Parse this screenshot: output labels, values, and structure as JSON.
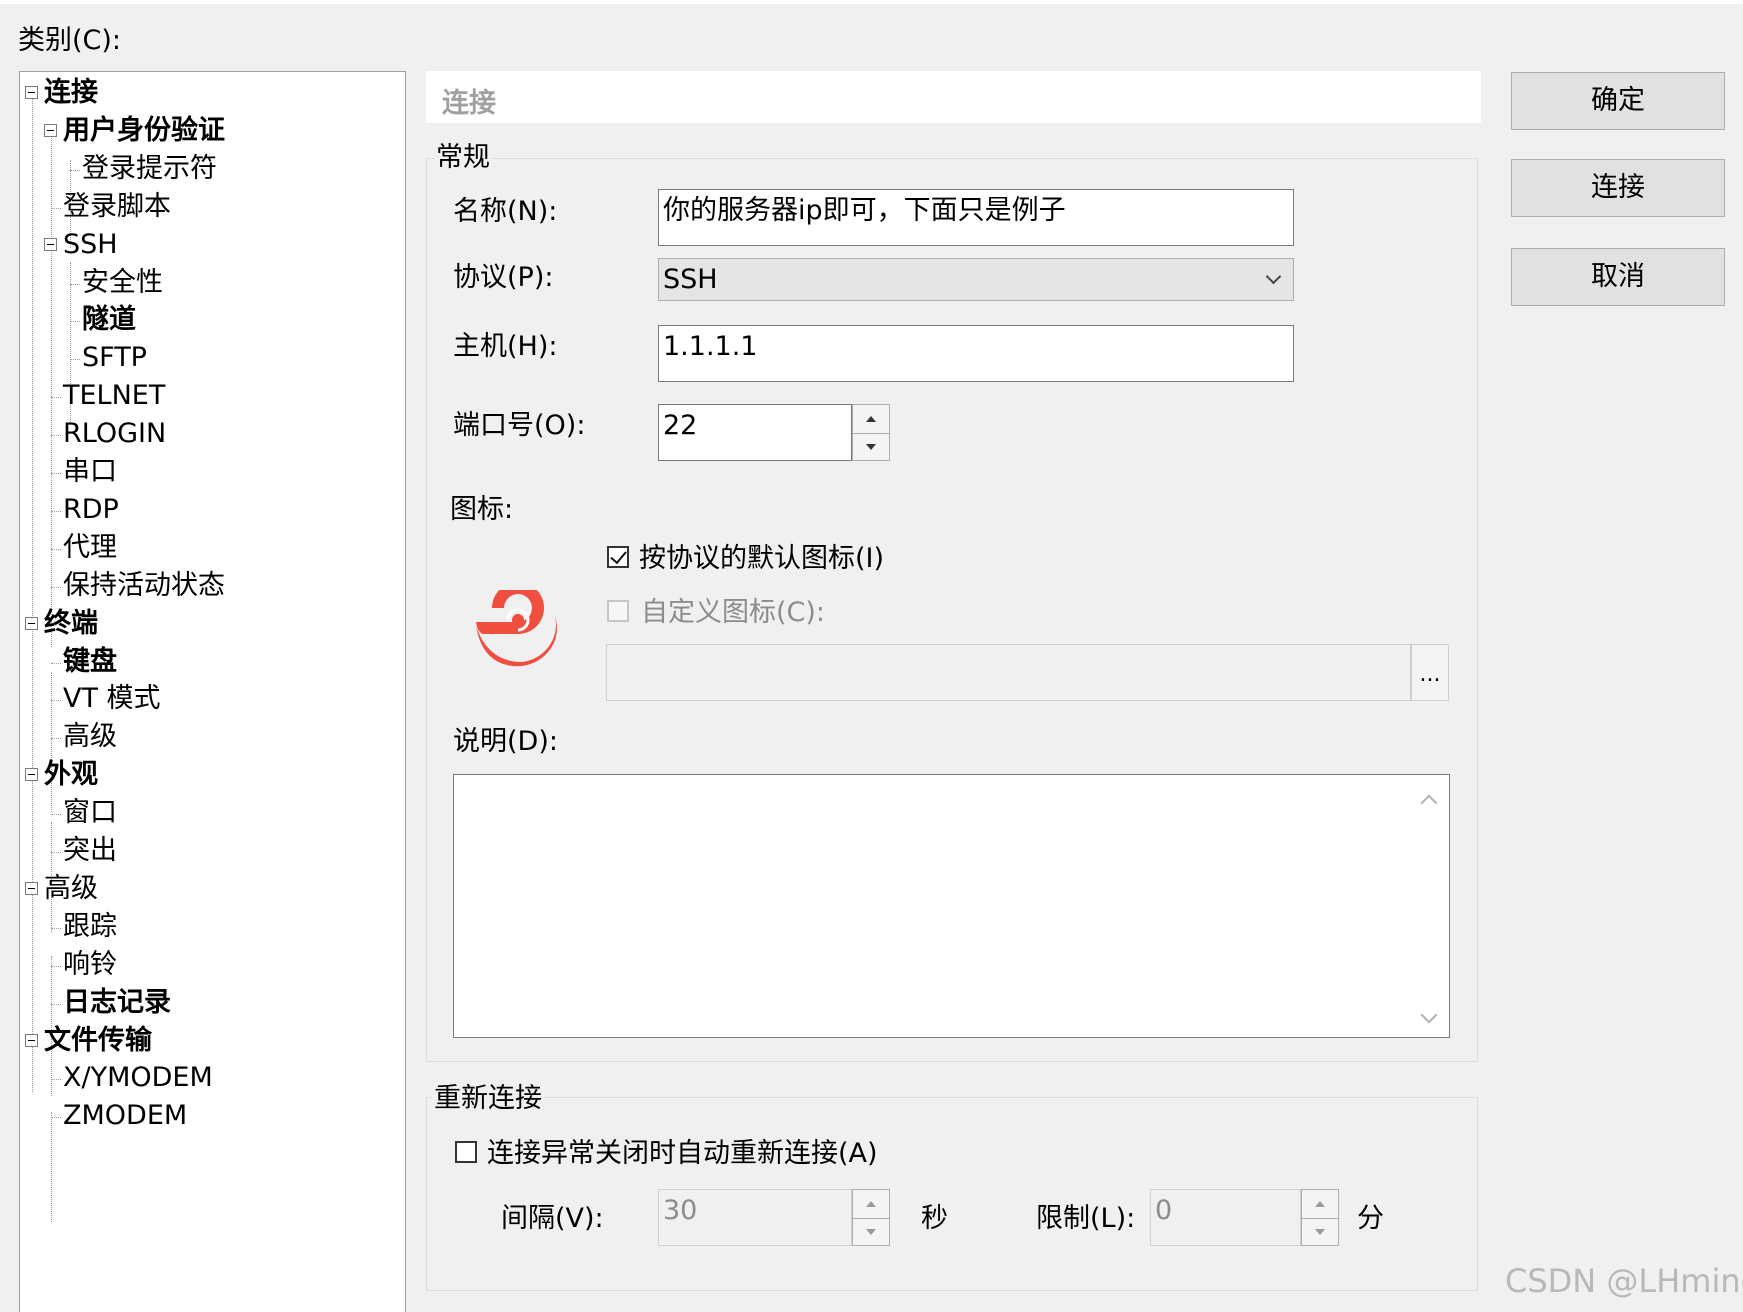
{
  "category_label": "类别(C):",
  "tree": [
    {
      "label": "连接",
      "depth": 0,
      "expanded": true,
      "bold": true
    },
    {
      "label": "用户身份验证",
      "depth": 1,
      "expanded": true,
      "bold": true
    },
    {
      "label": "登录提示符",
      "depth": 2
    },
    {
      "label": "登录脚本",
      "depth": 1
    },
    {
      "label": "SSH",
      "depth": 1,
      "expanded": true
    },
    {
      "label": "安全性",
      "depth": 2
    },
    {
      "label": "隧道",
      "depth": 2,
      "bold": true
    },
    {
      "label": "SFTP",
      "depth": 2
    },
    {
      "label": "TELNET",
      "depth": 1
    },
    {
      "label": "RLOGIN",
      "depth": 1
    },
    {
      "label": "串口",
      "depth": 1
    },
    {
      "label": "RDP",
      "depth": 1
    },
    {
      "label": "代理",
      "depth": 1
    },
    {
      "label": "保持活动状态",
      "depth": 1
    },
    {
      "label": "终端",
      "depth": 0,
      "expanded": true,
      "bold": true
    },
    {
      "label": "键盘",
      "depth": 1,
      "bold": true
    },
    {
      "label": "VT 模式",
      "depth": 1
    },
    {
      "label": "高级",
      "depth": 1
    },
    {
      "label": "外观",
      "depth": 0,
      "expanded": true,
      "bold": true
    },
    {
      "label": "窗口",
      "depth": 1
    },
    {
      "label": "突出",
      "depth": 1
    },
    {
      "label": "高级",
      "depth": 0,
      "expanded": true
    },
    {
      "label": "跟踪",
      "depth": 1
    },
    {
      "label": "响铃",
      "depth": 1
    },
    {
      "label": "日志记录",
      "depth": 1,
      "bold": true
    },
    {
      "label": "文件传输",
      "depth": 0,
      "expanded": true,
      "bold": true
    },
    {
      "label": "X/YMODEM",
      "depth": 1
    },
    {
      "label": "ZMODEM",
      "depth": 1
    }
  ],
  "header": {
    "title": "连接"
  },
  "general": {
    "group_title": "常规",
    "name_label": "名称(N):",
    "name_value": "你的服务器ip即可，下面只是例子",
    "protocol_label": "协议(P):",
    "protocol_value": "SSH",
    "host_label": "主机(H):",
    "host_value": "1.1.1.1",
    "port_label": "端口号(O):",
    "port_value": "22",
    "icon_label": "图标:",
    "default_icon_checkbox": "按协议的默认图标(I)",
    "default_icon_checked": true,
    "custom_icon_checkbox": "自定义图标(C):",
    "custom_icon_checked": false,
    "browse_label": "...",
    "icon_name": "ssh-spiral-icon",
    "icon_color": "#f04e3e",
    "description_label": "说明(D):"
  },
  "reconnect": {
    "group_title": "重新连接",
    "checkbox_label": "连接异常关闭时自动重新连接(A)",
    "checked": false,
    "interval_label": "间隔(V):",
    "interval_value": "30",
    "interval_unit": "秒",
    "limit_label": "限制(L):",
    "limit_value": "0",
    "limit_unit": "分"
  },
  "buttons": {
    "ok": "确定",
    "connect": "连接",
    "cancel": "取消"
  },
  "watermark": "CSDN @LHmine"
}
